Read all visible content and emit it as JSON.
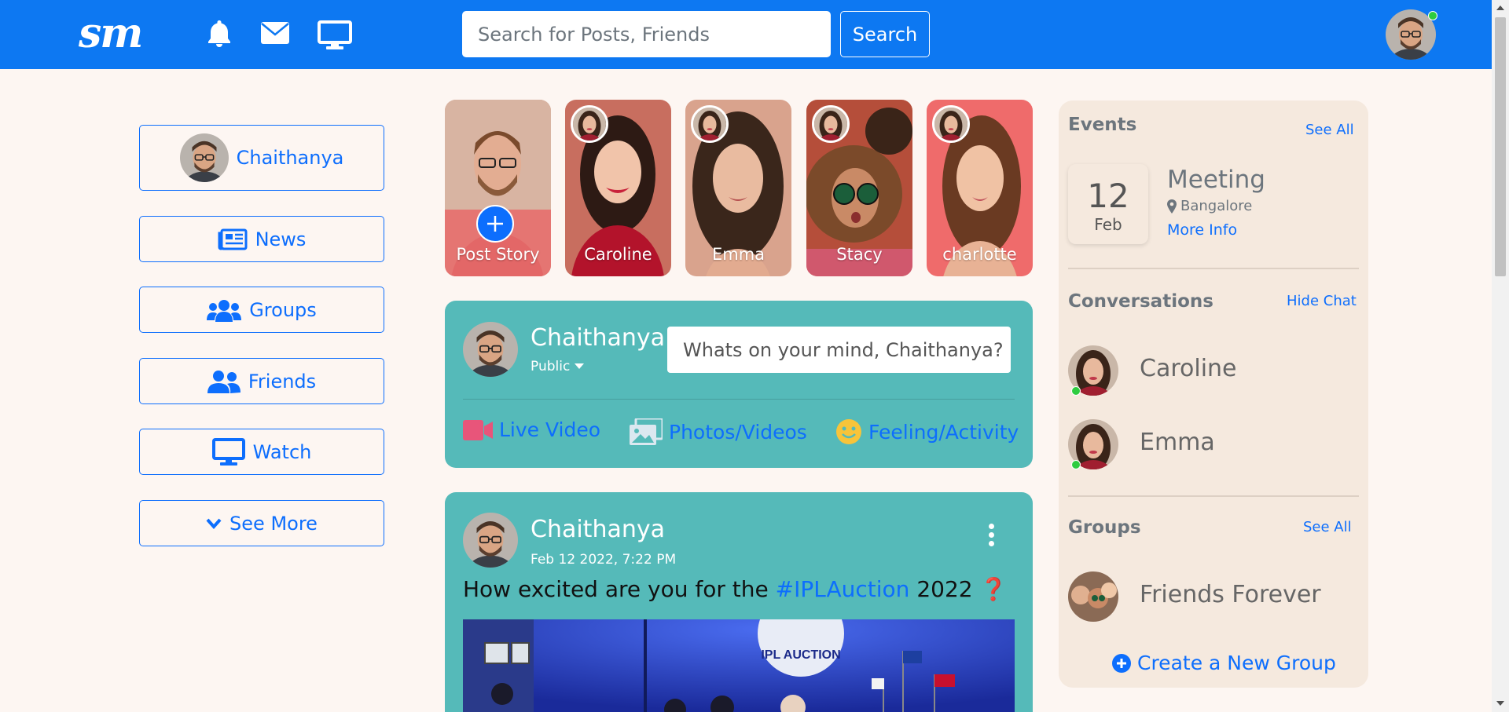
{
  "nav": {
    "logo": "sm",
    "search_placeholder": "Search for Posts, Friends",
    "search_button": "Search"
  },
  "sidebar": {
    "profile_name": "Chaithanya",
    "items": [
      {
        "label": "News",
        "icon": "newspaper-icon"
      },
      {
        "label": "Groups",
        "icon": "users-icon"
      },
      {
        "label": "Friends",
        "icon": "user-friends-icon"
      },
      {
        "label": "Watch",
        "icon": "tv-icon"
      },
      {
        "label": "See More",
        "icon": "chevron-down-icon"
      }
    ]
  },
  "stories": [
    {
      "label": "Post Story"
    },
    {
      "label": "Caroline"
    },
    {
      "label": "Emma"
    },
    {
      "label": "Stacy"
    },
    {
      "label": "charlotte"
    }
  ],
  "create_post": {
    "name": "Chaithanya",
    "visibility": "Public",
    "placeholder": "Whats on your mind, Chaithanya?",
    "actions": [
      {
        "label": "Live Video",
        "icon": "video-icon"
      },
      {
        "label": "Photos/Videos",
        "icon": "images-icon"
      },
      {
        "label": "Feeling/Activity",
        "icon": "smile-icon"
      }
    ]
  },
  "post": {
    "author": "Chaithanya",
    "timestamp": "Feb 12 2022, 7:22 PM",
    "text_before": "How excited are you for the ",
    "hashtag": "#IPLAuction",
    "text_after": " 2022",
    "emoji": "❓",
    "image_banner": "IPL AUCTION"
  },
  "events": {
    "title": "Events",
    "see_all": "See All",
    "day": "12",
    "month": "Feb",
    "event_title": "Meeting",
    "location": "Bangalore",
    "more_info": "More Info"
  },
  "conversations": {
    "title": "Conversations",
    "hide": "Hide Chat",
    "people": [
      {
        "name": "Caroline"
      },
      {
        "name": "Emma"
      }
    ]
  },
  "groups": {
    "title": "Groups",
    "see_all": "See All",
    "items": [
      {
        "name": "Friends Forever"
      }
    ],
    "create": "Create a New Group"
  },
  "colors": {
    "brand": "#0d78f2",
    "link": "#0d6efd",
    "card": "#55bab9",
    "panel": "#f5e9de",
    "online": "#2ecc40"
  }
}
